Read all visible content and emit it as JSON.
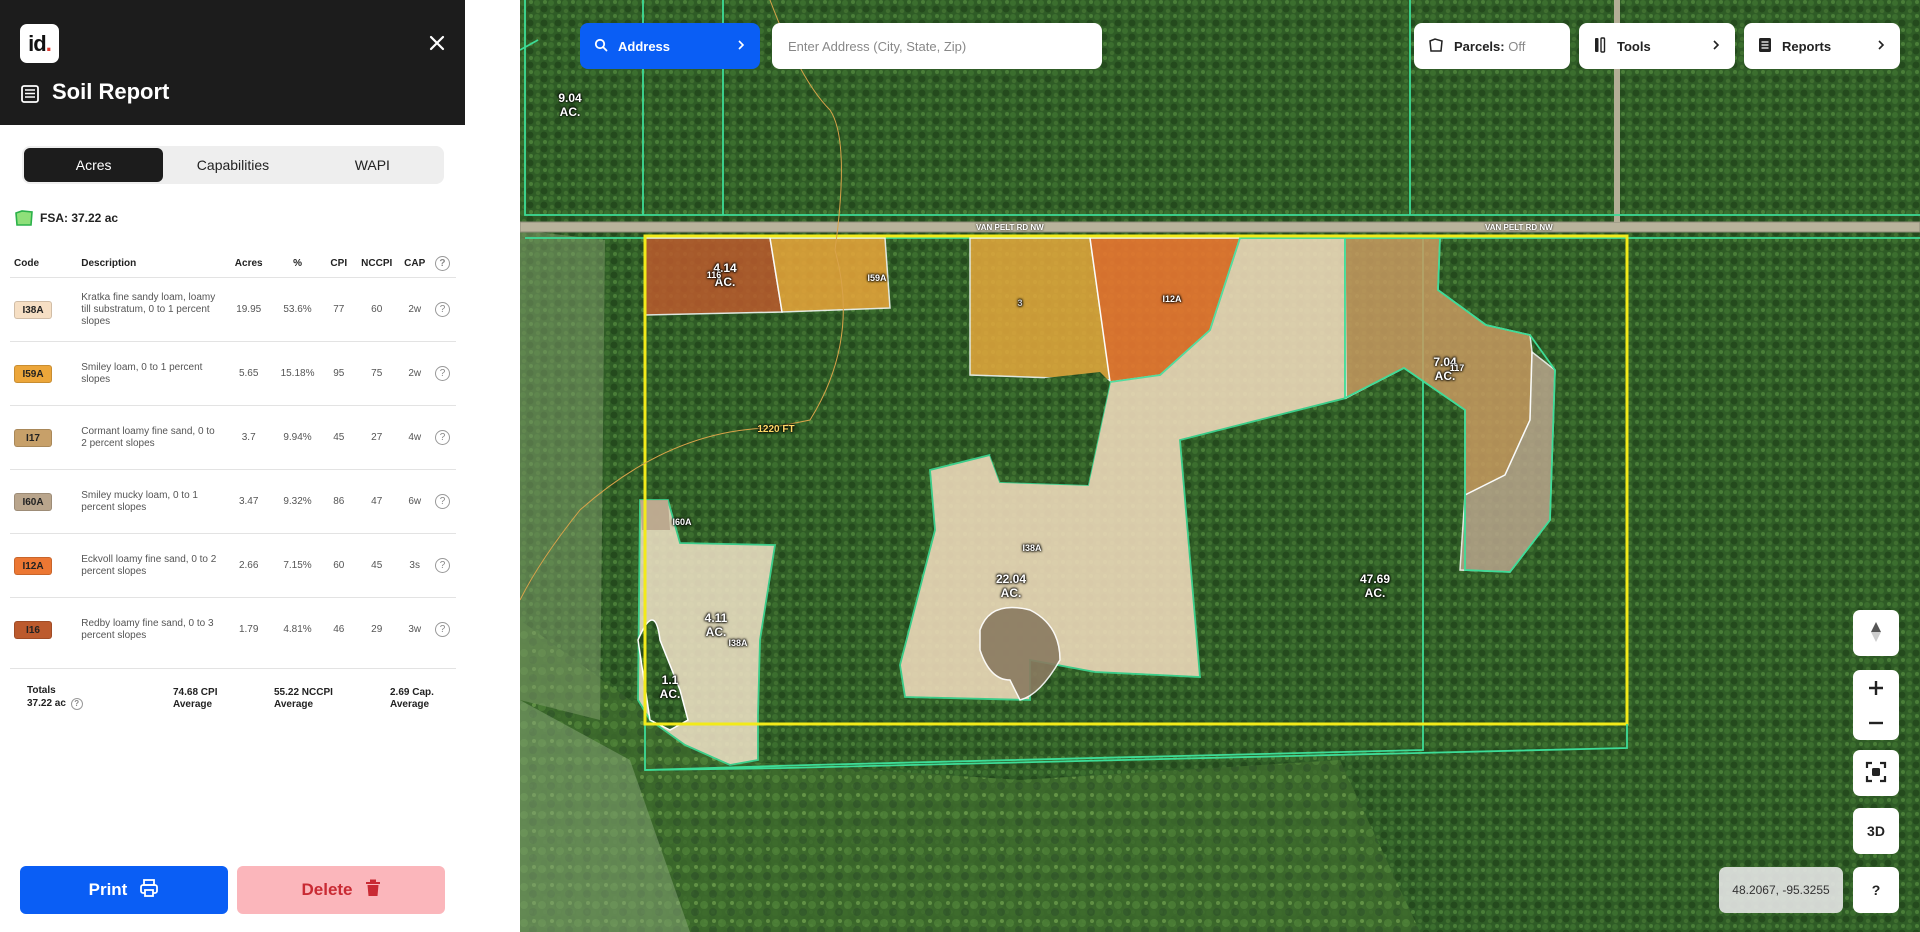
{
  "sidebar": {
    "logo_text": "id",
    "logo_dot": ".",
    "title": "Soil Report",
    "tabs": [
      {
        "label": "Acres",
        "active": true
      },
      {
        "label": "Capabilities",
        "active": false
      },
      {
        "label": "WAPI",
        "active": false
      }
    ],
    "fsa_label": "FSA: 37.22 ac",
    "columns": {
      "code": "Code",
      "description": "Description",
      "acres": "Acres",
      "pct": "%",
      "cpi": "CPI",
      "nccpi": "NCCPI",
      "cap": "CAP"
    },
    "rows": [
      {
        "code": "I38A",
        "color": "#f6dfc4",
        "description": "Kratka fine sandy loam, loamy till substratum, 0 to 1 percent slopes",
        "acres": "19.95",
        "pct": "53.6%",
        "cpi": "77",
        "nccpi": "60",
        "cap": "2w"
      },
      {
        "code": "I59A",
        "color": "#eca63a",
        "description": "Smiley loam, 0 to 1 percent slopes",
        "acres": "5.65",
        "pct": "15.18%",
        "cpi": "95",
        "nccpi": "75",
        "cap": "2w"
      },
      {
        "code": "I17",
        "color": "#c7a069",
        "description": "Cormant loamy fine sand, 0 to 2 percent slopes",
        "acres": "3.7",
        "pct": "9.94%",
        "cpi": "45",
        "nccpi": "27",
        "cap": "4w"
      },
      {
        "code": "I60A",
        "color": "#b9a58c",
        "description": "Smiley mucky loam, 0 to 1 percent slopes",
        "acres": "3.47",
        "pct": "9.32%",
        "cpi": "86",
        "nccpi": "47",
        "cap": "6w"
      },
      {
        "code": "I12A",
        "color": "#ec7733",
        "description": "Eckvoll loamy fine sand, 0 to 2 percent slopes",
        "acres": "2.66",
        "pct": "7.15%",
        "cpi": "60",
        "nccpi": "45",
        "cap": "3s"
      },
      {
        "code": "I16",
        "color": "#bc5a2d",
        "description": "Redby loamy fine sand, 0 to 3 percent slopes",
        "acres": "1.79",
        "pct": "4.81%",
        "cpi": "46",
        "nccpi": "29",
        "cap": "3w"
      }
    ],
    "totals": {
      "label": "Totals",
      "acres": "37.22 ac",
      "cpi_value": "74.68 CPI",
      "cpi_sub": "Average",
      "nccpi_value": "55.22 NCCPI",
      "nccpi_sub": "Average",
      "cap_value": "2.69 Cap.",
      "cap_sub": "Average"
    },
    "print_label": "Print",
    "delete_label": "Delete",
    "help_glyph": "?"
  },
  "map": {
    "address_label": "Address",
    "address_placeholder": "Enter Address (City, State, Zip)",
    "parcels_label": "Parcels:",
    "parcels_state": "Off",
    "tools_label": "Tools",
    "reports_label": "Reports",
    "btn_3d": "3D",
    "btn_help": "?",
    "coords": "48.2067, -95.3255",
    "road_name": "VAN PELT RD NW",
    "distance_label": "1220 FT",
    "labels": {
      "a904": "9.04\nAC.",
      "a414": "4.14\nAC.",
      "a704": "7.04\nAC.",
      "a2204": "22.04\nAC.",
      "a4769": "47.69\nAC.",
      "a411": "4.11\nAC.",
      "a11": "1.1\nAC.",
      "i59a": "I59A",
      "i12a": "I12A",
      "i38a_main": "I38A",
      "i38a_small": "I38A",
      "i60a": "I60A",
      "i16": "116",
      "i17": "117",
      "three": "3"
    }
  }
}
